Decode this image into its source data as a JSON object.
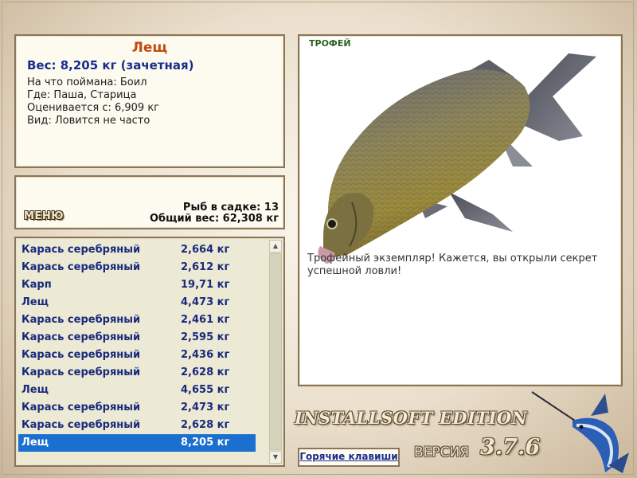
{
  "fish_info": {
    "name": "Лещ",
    "weight": "Вес: 8,205 кг (зачетная)",
    "bait": "На что поймана: Боил",
    "location": "Где: Паша, Старица",
    "rated_from": "Оценивается с: 6,909 кг",
    "species_note": "Вид: Ловится не часто"
  },
  "summary": {
    "menu_label": "МЕНЮ",
    "fish_count": "Рыб в садке: 13",
    "total_weight": "Общий вес: 62,308 кг"
  },
  "catch_list": [
    {
      "name": "Карась серебряный",
      "weight": "2,664 кг"
    },
    {
      "name": "Карась серебряный",
      "weight": "2,612 кг"
    },
    {
      "name": "Карп",
      "weight": "19,71 кг"
    },
    {
      "name": "Лещ",
      "weight": "4,473 кг"
    },
    {
      "name": "Карась серебряный",
      "weight": "2,461 кг"
    },
    {
      "name": "Карась серебряный",
      "weight": "2,595 кг"
    },
    {
      "name": "Карась серебряный",
      "weight": "2,436 кг"
    },
    {
      "name": "Карась серебряный",
      "weight": "2,628 кг"
    },
    {
      "name": "Лещ",
      "weight": "4,655 кг"
    },
    {
      "name": "Карась серебряный",
      "weight": "2,473 кг"
    },
    {
      "name": "Карась серебряный",
      "weight": "2,628 кг"
    },
    {
      "name": "Лещ",
      "weight": "8,205 кг",
      "selected": true
    }
  ],
  "trophy": {
    "badge": "ТРОФЕЙ",
    "description": "Трофейный экземпляр! Кажется, вы открыли секрет успешной ловли!"
  },
  "footer": {
    "hotkeys_label": "Горячие клавиши",
    "edition": "INSTALLSOFT EDITION",
    "version_label": "ВЕРСИЯ",
    "version_number": "3.7.6"
  },
  "colors": {
    "fish_name": "#c4480e",
    "weight_text": "#1a2d8c",
    "list_text": "#1a2a7c",
    "selection": "#1a6fcf",
    "panel_border": "#8a7558",
    "trophy_badge": "#2f5e1f"
  },
  "icons": {
    "fish_image": "bream-fish-image",
    "logo": "marlin-logo"
  }
}
